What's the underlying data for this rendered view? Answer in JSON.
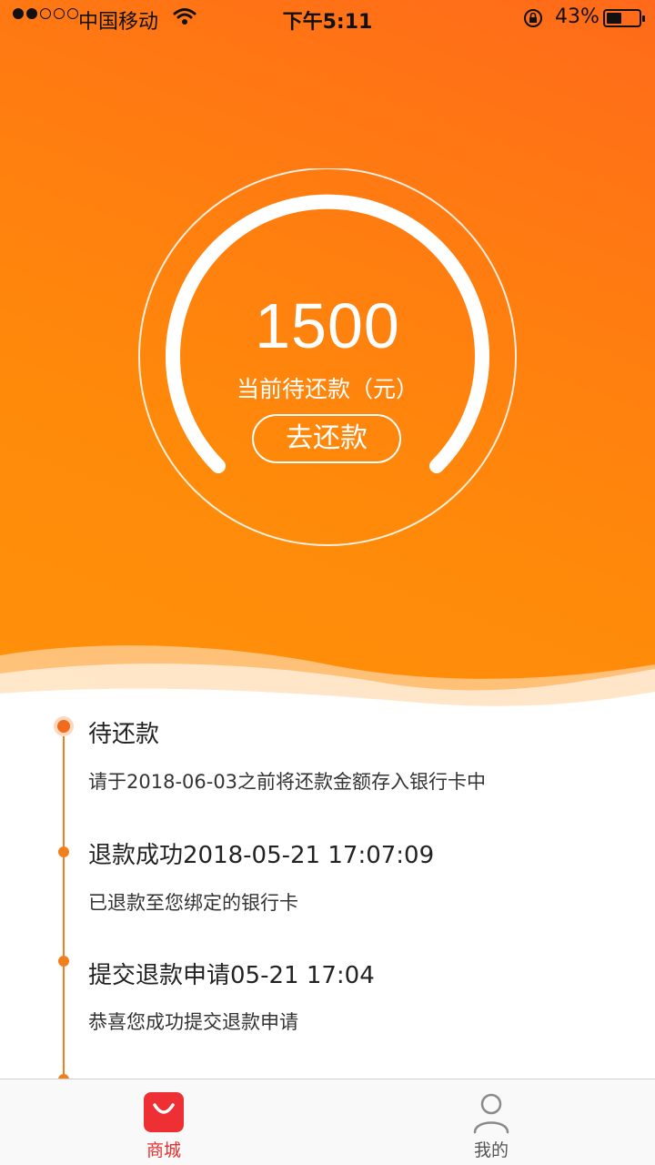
{
  "status_bar": {
    "carrier": "中国移动",
    "time": "下午5:11",
    "battery": "43%"
  },
  "balance": {
    "amount": "1500",
    "label": "当前待还款（元）",
    "repay_button": "去还款"
  },
  "timeline": [
    {
      "title": "待还款",
      "desc": "请于2018-06-03之前将还款金额存入银行卡中"
    },
    {
      "title": "退款成功2018-05-21 17:07:09",
      "desc": "已退款至您绑定的银行卡"
    },
    {
      "title": "提交退款申请05-21 17:04",
      "desc": "恭喜您成功提交退款申请"
    }
  ],
  "tabs": [
    {
      "label": "商城",
      "icon": "shopping-bag-icon"
    },
    {
      "label": "我的",
      "icon": "user-icon"
    }
  ],
  "colors": {
    "accent": "#f0801e",
    "hero_top": "#ff6a1a",
    "hero_bottom": "#ff910a",
    "tab_active": "#e8302f"
  }
}
